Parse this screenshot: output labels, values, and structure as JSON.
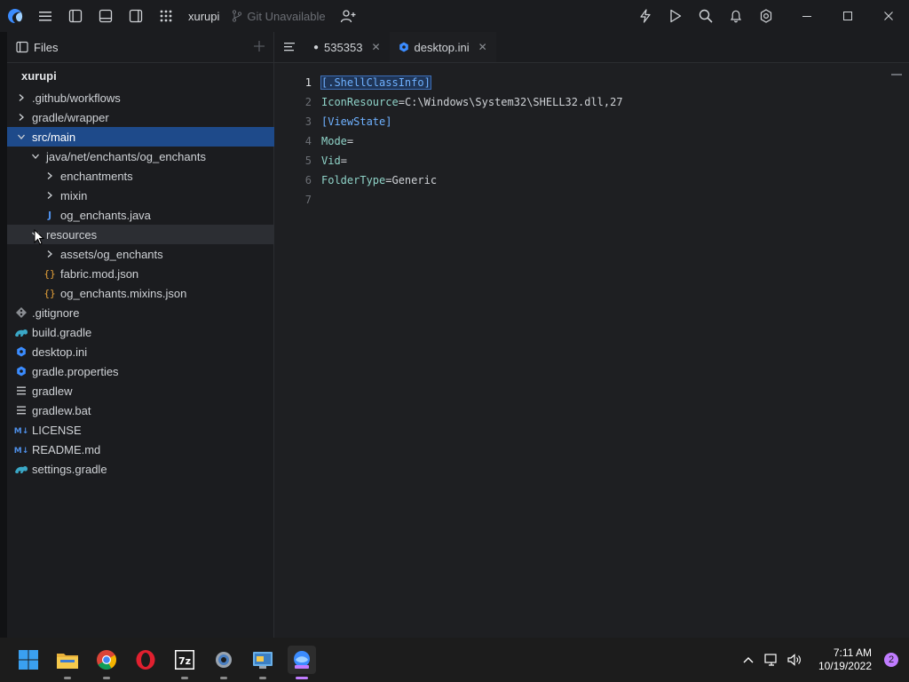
{
  "titlebar": {
    "project": "xurupi",
    "git_status": "Git Unavailable"
  },
  "sidebar": {
    "title": "Files",
    "root": "xurupi",
    "rows": [
      {
        "label": ".github/workflows",
        "icon": "chevron-right-icon",
        "depth": 0
      },
      {
        "label": "gradle/wrapper",
        "icon": "chevron-right-icon",
        "depth": 0
      },
      {
        "label": "src/main",
        "icon": "chevron-down-icon",
        "depth": 0,
        "selected": true
      },
      {
        "label": "java/net/enchants/og_enchants",
        "icon": "chevron-down-icon",
        "depth": 1
      },
      {
        "label": "enchantments",
        "icon": "chevron-right-icon",
        "depth": 2
      },
      {
        "label": "mixin",
        "icon": "chevron-right-icon",
        "depth": 2
      },
      {
        "label": "og_enchants.java",
        "icon": "java-file-icon",
        "depth": 2
      },
      {
        "label": "resources",
        "icon": "chevron-down-icon",
        "depth": 1,
        "hovered": true
      },
      {
        "label": "assets/og_enchants",
        "icon": "chevron-right-icon",
        "depth": 2
      },
      {
        "label": "fabric.mod.json",
        "icon": "json-file-icon",
        "depth": 2
      },
      {
        "label": "og_enchants.mixins.json",
        "icon": "json-file-icon",
        "depth": 2
      },
      {
        "label": ".gitignore",
        "icon": "git-file-icon",
        "depth": 0
      },
      {
        "label": "build.gradle",
        "icon": "gradle-file-icon",
        "depth": 0
      },
      {
        "label": "desktop.ini",
        "icon": "settings-file-icon",
        "depth": 0
      },
      {
        "label": "gradle.properties",
        "icon": "settings-file-icon",
        "depth": 0
      },
      {
        "label": "gradlew",
        "icon": "text-file-icon",
        "depth": 0
      },
      {
        "label": "gradlew.bat",
        "icon": "text-file-icon",
        "depth": 0
      },
      {
        "label": "LICENSE",
        "icon": "markdown-file-icon",
        "depth": 0
      },
      {
        "label": "README.md",
        "icon": "markdown-file-icon",
        "depth": 0
      },
      {
        "label": "settings.gradle",
        "icon": "gradle-file-icon",
        "depth": 0
      }
    ]
  },
  "tabs": [
    {
      "label": "535353",
      "modified": true,
      "active": false
    },
    {
      "label": "desktop.ini",
      "modified": false,
      "active": true
    }
  ],
  "editor": {
    "current_line": 1,
    "lines": [
      {
        "n": "1",
        "key": "[.ShellClassInfo]",
        "val": ""
      },
      {
        "n": "2",
        "key": "IconResource",
        "val": "C:\\Windows\\System32\\SHELL32.dll,27"
      },
      {
        "n": "3",
        "key": "[ViewState]",
        "val": ""
      },
      {
        "n": "4",
        "key": "Mode",
        "val": ""
      },
      {
        "n": "5",
        "key": "Vid",
        "val": ""
      },
      {
        "n": "6",
        "key": "FolderType",
        "val": "Generic"
      },
      {
        "n": "7",
        "key": "",
        "val": ""
      }
    ]
  },
  "taskbar": {
    "apps": [
      "windows-start-icon",
      "file-explorer-icon",
      "chrome-icon",
      "opera-icon",
      "7zip-icon",
      "settings-icon",
      "control-panel-icon",
      "ide-app-icon"
    ],
    "time": "7:11 AM",
    "date": "10/19/2022",
    "notifications": "2"
  },
  "colors": {
    "selection": "#1e4a8a",
    "accent": "#c07cff",
    "keyword": "#8fd3c8",
    "section": "#6fb1ff"
  }
}
